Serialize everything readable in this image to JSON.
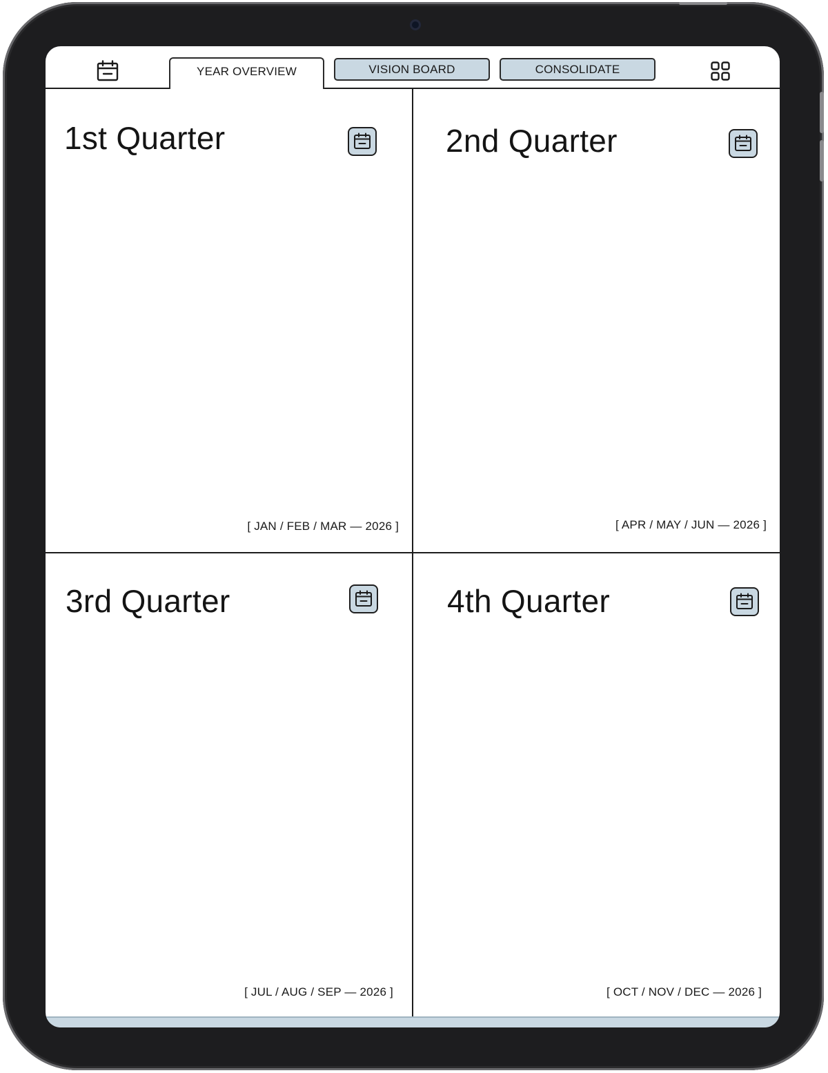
{
  "tabs": {
    "year_overview": "YEAR OVERVIEW",
    "vision_board": "VISION BOARD",
    "consolidate": "CONSOLIDATE"
  },
  "icons": {
    "left": "calendar-icon",
    "right": "grid-icon",
    "quarter": "calendar-icon"
  },
  "quarters": [
    {
      "title": "1st Quarter",
      "range": "[ JAN / FEB / MAR — 2026 ]"
    },
    {
      "title": "2nd Quarter",
      "range": "[ APR / MAY / JUN — 2026 ]"
    },
    {
      "title": "3rd Quarter",
      "range": "[ JUL / AUG / SEP — 2026 ]"
    },
    {
      "title": "4th Quarter",
      "range": "[ OCT / NOV / DEC — 2026 ]"
    }
  ],
  "colors": {
    "accent": "#c9d8e2",
    "line": "#1c1c1c",
    "bezel": "#1d1d1f"
  }
}
